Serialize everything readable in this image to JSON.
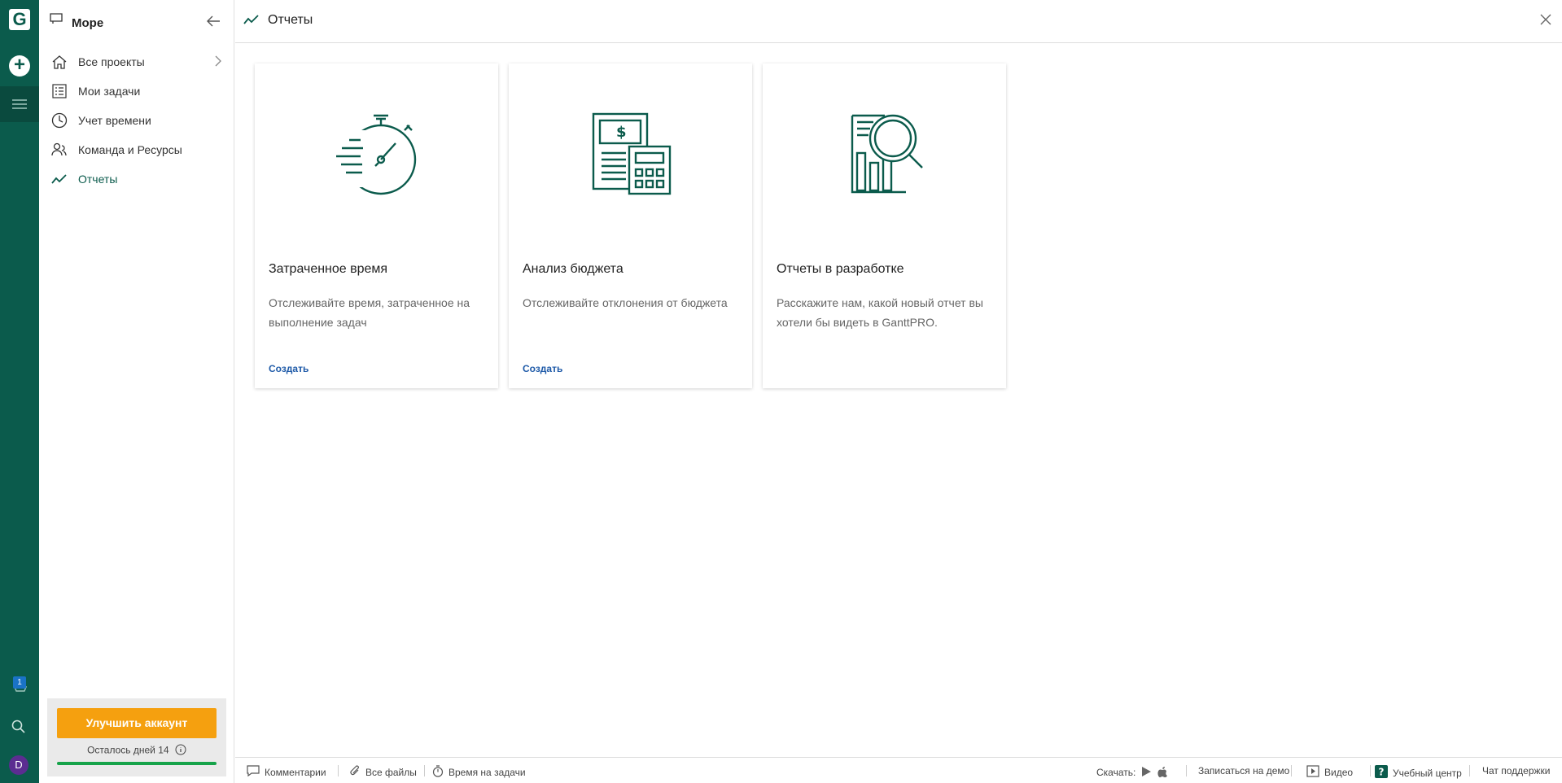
{
  "rail": {
    "logo": "G",
    "plus": "+",
    "badge_count": "1",
    "avatar": "D"
  },
  "sidebar": {
    "project_title": "Море",
    "items": [
      {
        "label": "Все проекты"
      },
      {
        "label": "Мои задачи"
      },
      {
        "label": "Учет времени"
      },
      {
        "label": "Команда и Ресурсы"
      },
      {
        "label": "Отчеты"
      }
    ],
    "upgrade_label": "Улучшить аккаунт",
    "days_left": "Осталось дней 14"
  },
  "header": {
    "title": "Отчеты"
  },
  "cards": [
    {
      "title": "Затраченное время",
      "desc": "Отслеживайте время, затраченное на выполнение задач",
      "link": "Создать"
    },
    {
      "title": "Анализ бюджета",
      "desc": "Отслеживайте отклонения от бюджета",
      "link": "Создать"
    },
    {
      "title": "Отчеты в разработке",
      "desc": "Расскажите нам, какой новый отчет вы хотели бы видеть в GanttPRO.",
      "link": ""
    }
  ],
  "footer": {
    "comments": "Комментарии",
    "files": "Все файлы",
    "time": "Время на задачи",
    "download": "Скачать:",
    "demo": "Записаться на демо",
    "video": "Видео",
    "learning": "Учебный центр",
    "support": "Чат поддержки"
  },
  "colors": {
    "brand": "#0b5b4c",
    "accent": "#f5a00f",
    "link": "#1e5aa8"
  }
}
